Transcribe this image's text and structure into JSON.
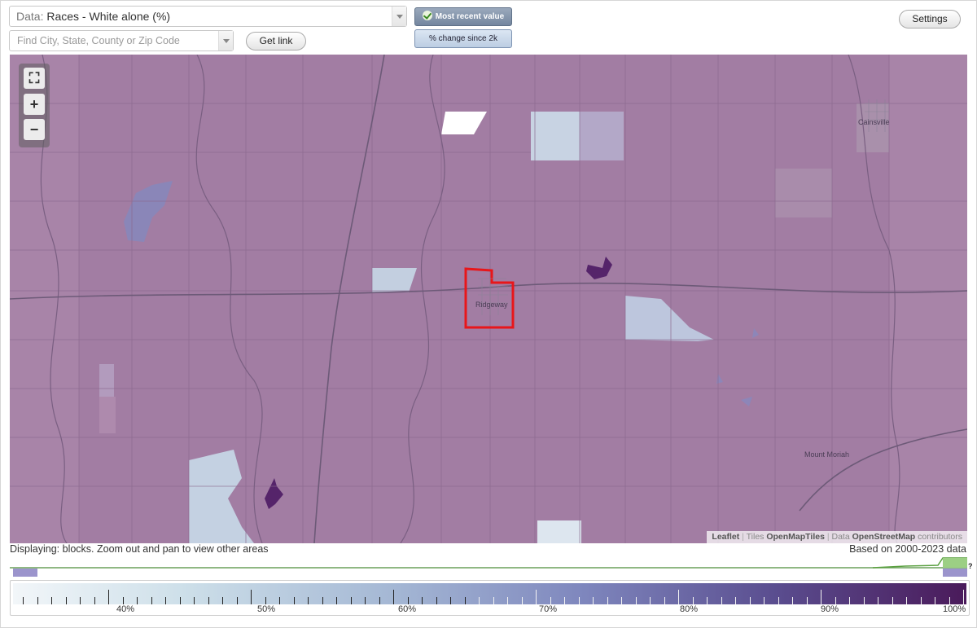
{
  "data_select": {
    "prefix": "Data:",
    "value": "Races - White alone (%)"
  },
  "search": {
    "placeholder": "Find City, State, County or Zip Code"
  },
  "buttons": {
    "get_link": "Get link",
    "settings": "Settings"
  },
  "toggles": {
    "most_recent": "Most recent value",
    "pct_change": "% change since 2k"
  },
  "zoom": {
    "fullscreen": "⛶",
    "zoom_in": "+",
    "zoom_out": "−"
  },
  "map": {
    "labels": {
      "cainsville": "Cainsville",
      "ridgeway": "Ridgeway",
      "mount_moriah": "Mount Moriah"
    },
    "attribution": {
      "leaflet": "Leaflet",
      "tiles_label": "Tiles",
      "tiles_source": "OpenMapTiles",
      "data_label": "Data",
      "data_source": "OpenStreetMap",
      "contributors": "contributors"
    },
    "colors": {
      "base": "#a27da3",
      "light": "#bccbdc",
      "medium": "#9b8fb8",
      "dark": "#5a2a6a",
      "highlight": "#e8161a"
    }
  },
  "status": {
    "displaying": "Displaying: blocks. Zoom out and pan to view other areas",
    "based_on": "Based on 2000-2023 data"
  },
  "histogram": {
    "help": "?"
  },
  "legend": {
    "labels": [
      "40%",
      "50%",
      "60%",
      "70%",
      "80%",
      "90%",
      "100%"
    ]
  }
}
